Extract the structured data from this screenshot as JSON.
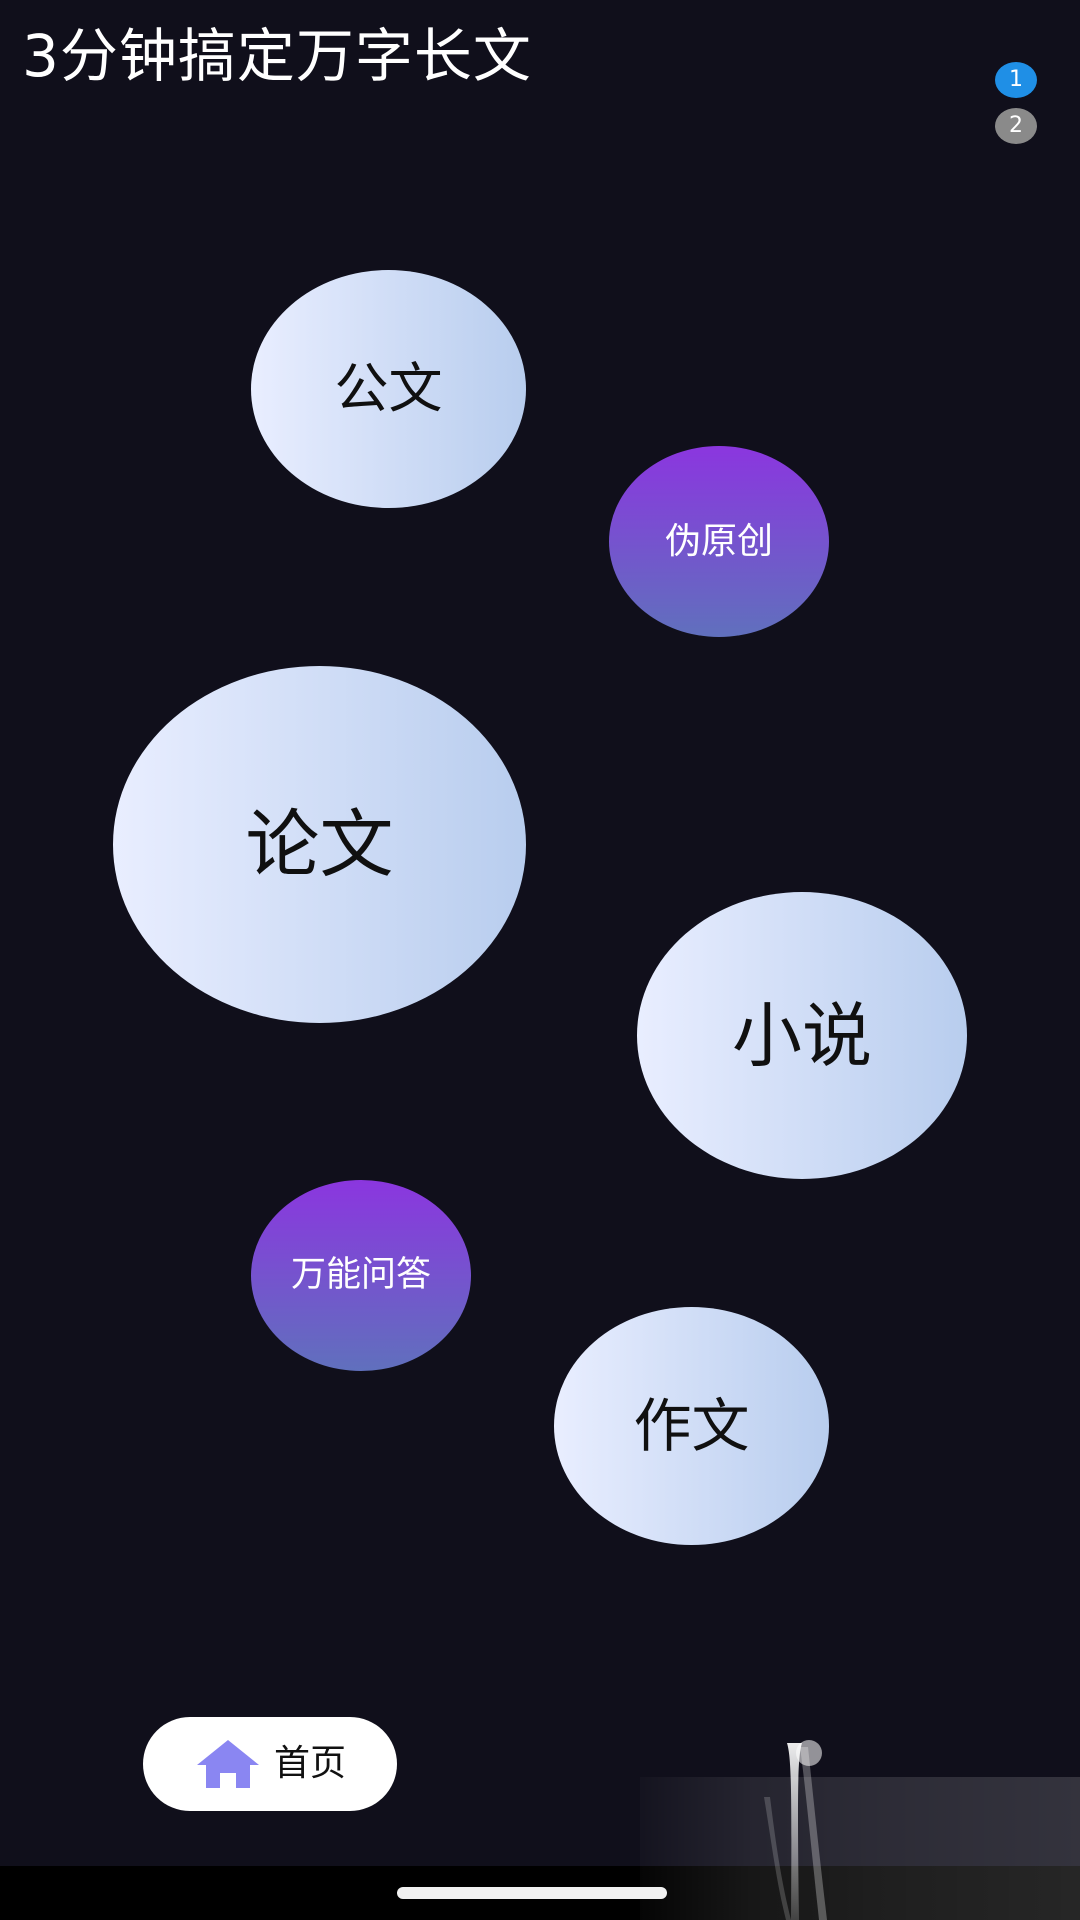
{
  "title": "3分钟搞定万字长文",
  "pager": {
    "pages": [
      "1",
      "2"
    ],
    "active_index": 0,
    "active_color": "#1f8fe6",
    "inactive_color": "#8a8a8a"
  },
  "bubbles": [
    {
      "id": "gongwen",
      "label": "公文",
      "style": "light"
    },
    {
      "id": "weiyuanchuang",
      "label": "伪原创",
      "style": "purple"
    },
    {
      "id": "lunwen",
      "label": "论文",
      "style": "light"
    },
    {
      "id": "xiaoshuo",
      "label": "小说",
      "style": "light"
    },
    {
      "id": "wanneng-wenda",
      "label": "万能问答",
      "style": "purple"
    },
    {
      "id": "zuowen",
      "label": "作文",
      "style": "light"
    }
  ],
  "colors": {
    "background": "#100f1b",
    "light_bubble_from": "#e9eeff",
    "light_bubble_to": "#b8cdee",
    "purple_bubble_from": "#8b36df",
    "purple_bubble_to": "#6070bd",
    "home_icon": "#8a86f2",
    "system_bar": "#000000"
  },
  "home_button": {
    "label": "首页",
    "icon": "home-icon"
  }
}
